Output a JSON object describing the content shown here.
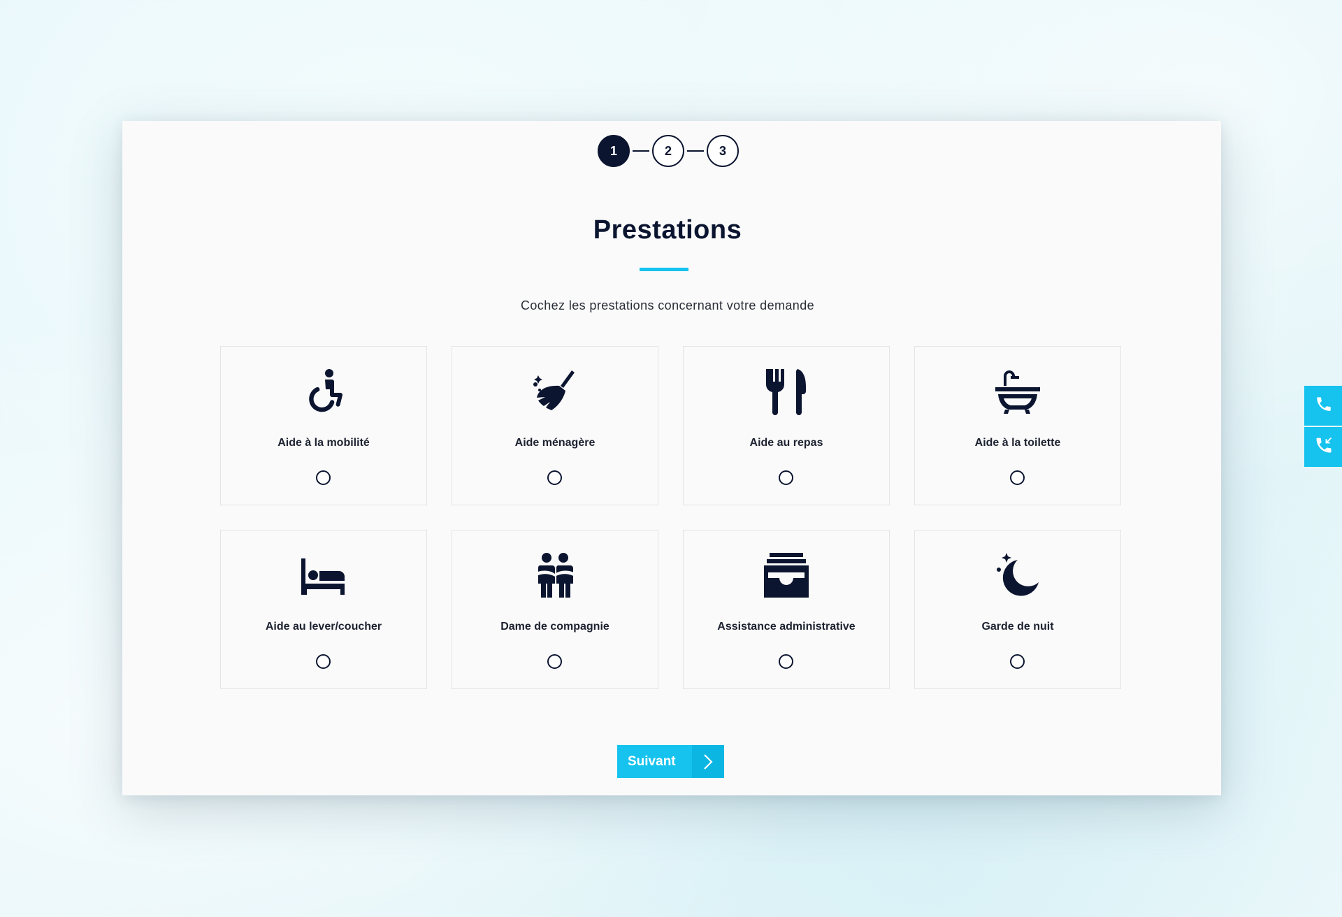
{
  "stepper": {
    "steps": [
      "1",
      "2",
      "3"
    ],
    "active_step": "1"
  },
  "title": "Prestations",
  "subtitle": "Cochez les prestations concernant votre demande",
  "options": [
    {
      "label": "Aide à la mobilité",
      "icon": "wheelchair-icon"
    },
    {
      "label": "Aide ménagère",
      "icon": "broom-icon"
    },
    {
      "label": "Aide au repas",
      "icon": "utensils-icon"
    },
    {
      "label": "Aide à la toilette",
      "icon": "bathtub-icon"
    },
    {
      "label": "Aide au lever/coucher",
      "icon": "bed-icon"
    },
    {
      "label": "Dame de compagnie",
      "icon": "companions-icon"
    },
    {
      "label": "Assistance administrative",
      "icon": "inbox-tray-icon"
    },
    {
      "label": "Garde de nuit",
      "icon": "moon-icon"
    }
  ],
  "next_button": {
    "label": "Suivant",
    "icon": "chevron-right-icon"
  },
  "side_buttons": [
    {
      "icon": "phone-icon"
    },
    {
      "icon": "phone-callback-icon"
    }
  ],
  "colors": {
    "accent": "#15c3ee",
    "dark": "#0b1530",
    "card_bg": "#fafafa"
  }
}
